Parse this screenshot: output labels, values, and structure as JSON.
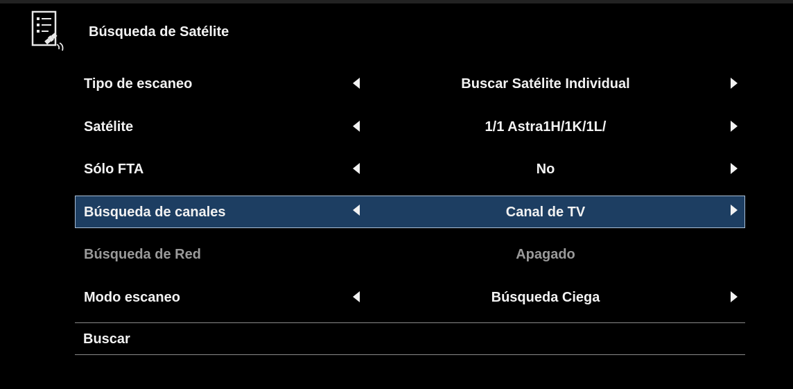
{
  "header": {
    "title": "Búsqueda de Satélite",
    "icon": "satellite-settings-icon"
  },
  "menu": {
    "rows": [
      {
        "label": "Tipo de escaneo",
        "value": "Buscar Satélite Individual"
      },
      {
        "label": "Satélite",
        "value": "1/1 Astra1H/1K/1L/"
      },
      {
        "label": "Sólo FTA",
        "value": "No"
      },
      {
        "label": "Búsqueda de canales",
        "value": "Canal de TV"
      },
      {
        "label": "Búsqueda de Red",
        "value": "Apagado"
      },
      {
        "label": "Modo escaneo",
        "value": "Búsqueda Ciega"
      }
    ],
    "selected_index": 3,
    "search_label": "Buscar"
  },
  "colors": {
    "background": "#000000",
    "highlight": "#1d3e62",
    "highlight_border": "#a9bfd6",
    "text": "#f2f2f2",
    "disabled_text": "#9a9a9a"
  }
}
